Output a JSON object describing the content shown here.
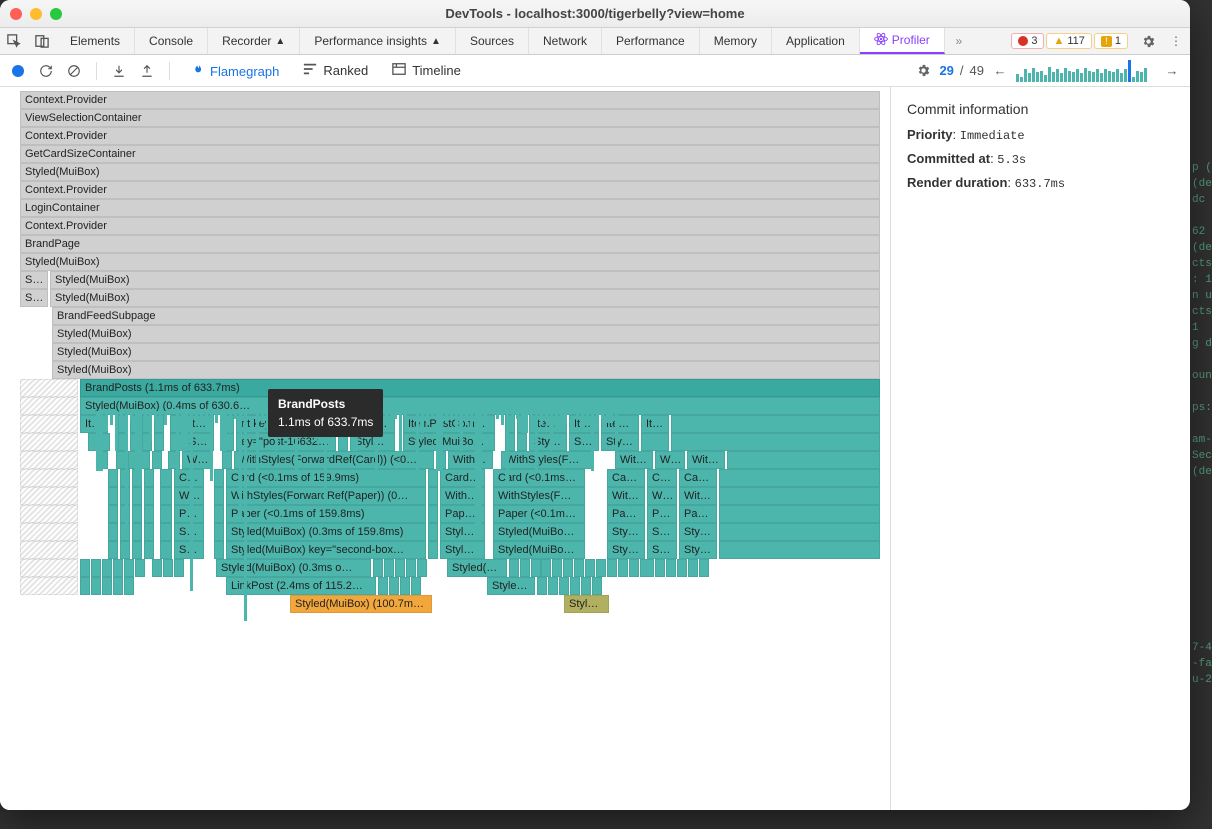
{
  "window": {
    "title": "DevTools - localhost:3000/tigerbelly?view=home"
  },
  "tabs": {
    "items": [
      "Elements",
      "Console",
      "Recorder",
      "Performance insights",
      "Sources",
      "Network",
      "Performance",
      "Memory",
      "Application",
      "Profiler"
    ],
    "active": "Profiler",
    "error_count": "3",
    "warn_count": "117",
    "info_count": "1"
  },
  "toolbar": {
    "views": {
      "flamegraph": "Flamegraph",
      "ranked": "Ranked",
      "timeline": "Timeline"
    },
    "commit_current": "29",
    "commit_sep": "/",
    "commit_total": "49"
  },
  "sidebar": {
    "title": "Commit information",
    "priority_label": "Priority",
    "priority_value": "Immediate",
    "committed_label": "Committed at",
    "committed_value": "5.3s",
    "duration_label": "Render duration",
    "duration_value": "633.7ms"
  },
  "flame": {
    "r0": "Context.Provider",
    "r1": "ViewSelectionContainer",
    "r2": "Context.Provider",
    "r3": "GetCardSizeContainer",
    "r4": "Styled(MuiBox)",
    "r5": "Context.Provider",
    "r6": "LoginContainer",
    "r7": "Context.Provider",
    "r8": "BrandPage",
    "r9": "Styled(MuiBox)",
    "r10a": "St…",
    "r10b": "Styled(MuiBox)",
    "r11a": "Si…",
    "r11b": "Styled(MuiBox)",
    "r12": "BrandFeedSubpage",
    "r13": "Styled(MuiBox)",
    "r14": "Styled(MuiBox)",
    "r15": "Styled(MuiBox)",
    "r16": "BrandPosts (1.1ms of 633.7ms)",
    "r17": "Styled(MuiBox) (0.4ms of 630.6…",
    "c_ite": "Ite…",
    "c_item": "Item…",
    "c_itemp": "ItemP…",
    "c_itempost": "ItemPostCom…",
    "c_key": "nt key=\"445d65…",
    "c_styl": "Styl…",
    "c_styled": "Styled(MuiBo…",
    "c_keypost": "ey=\"post-166327…",
    "c_wit": "Wit…",
    "c_with": "With…",
    "c_withs": "WithStyles(F…",
    "c_withforward": "WithStyles(ForwardRef(Card)) (<0…",
    "c_car": "Car…",
    "c_card": "Card …",
    "c_cardlt": "Card (<0.1ms of 159.9ms)",
    "c_cardlt2": "Card (<0.1ms…",
    "c_ca": "Ca…",
    "c_withpaper": "WithStyles(ForwardRef(Paper)) (0…",
    "c_pa": "Pa…",
    "c_pape": "Pape…",
    "c_paper": "Paper (<0.1ms of 159.8ms)",
    "c_paper2": "Paper (<0.1m…",
    "c_smb03": "Styled(MuiBox) (0.3ms of 159.8ms)",
    "c_smbkey": "Styled(MuiBox) key=\"second-box…",
    "c_smb03o": "Styled(MuiBox) (0.3ms o…",
    "c_linkpost": "LinkPost (2.4ms of 115.2…",
    "c_smb100": "Styled(MuiBox) (100.7m…",
    "c_styledm": "Styled(M…",
    "c_styledp": "Styled(…",
    "c_styleds": "Styled…",
    "c_st": "St…"
  },
  "tooltip": {
    "name": "BrandPosts",
    "detail": "1.1ms of 633.7ms"
  }
}
